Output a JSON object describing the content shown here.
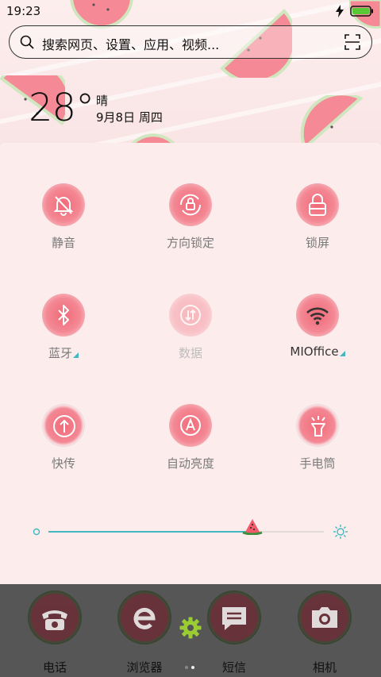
{
  "status_bar": {
    "time": "19:23"
  },
  "search": {
    "placeholder": "搜索网页、设置、应用、视频..."
  },
  "weather": {
    "temperature": "28°",
    "condition": "晴",
    "date": "9月8日 周四"
  },
  "quick_settings": {
    "tiles": [
      {
        "label": "静音",
        "icon": "bell-off-icon",
        "state": "on"
      },
      {
        "label": "方向锁定",
        "icon": "rotation-lock-icon",
        "state": "on"
      },
      {
        "label": "锁屏",
        "icon": "lock-icon",
        "state": "on"
      },
      {
        "label": "蓝牙",
        "icon": "bluetooth-icon",
        "state": "on",
        "has_menu": true
      },
      {
        "label": "数据",
        "icon": "mobile-data-icon",
        "state": "disabled"
      },
      {
        "label": "MIOffice",
        "icon": "wifi-icon",
        "state": "active",
        "has_menu": true
      },
      {
        "label": "快传",
        "icon": "share-transfer-icon",
        "state": "on"
      },
      {
        "label": "自动亮度",
        "icon": "auto-brightness-icon",
        "state": "on"
      },
      {
        "label": "手电筒",
        "icon": "flashlight-icon",
        "state": "on"
      }
    ],
    "brightness": {
      "level": 0.74
    }
  },
  "dock": {
    "apps": [
      {
        "label": "电话",
        "icon": "phone-icon"
      },
      {
        "label": "浏览器",
        "icon": "browser-icon"
      },
      {
        "label": "短信",
        "icon": "message-icon"
      },
      {
        "label": "相机",
        "icon": "camera-icon"
      }
    ],
    "pages": {
      "count": 2,
      "active": 2
    }
  },
  "colors": {
    "accent": "#43b8c2",
    "melon_red": "#f26a78",
    "rind_green": "#b9d9a0",
    "dock_bg": "#565656",
    "panel_bg": "#fcecec"
  }
}
